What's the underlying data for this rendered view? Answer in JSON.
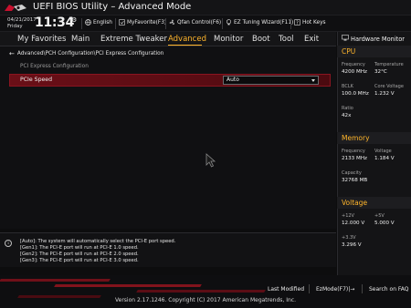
{
  "header": {
    "title": "UEFI BIOS Utility – Advanced Mode",
    "date": "04/21/2017",
    "day": "Friday",
    "time": "11:34",
    "tools": [
      {
        "label": "English",
        "icon": "globe-icon"
      },
      {
        "label": "MyFavorite(F3)",
        "icon": "favorite-icon"
      },
      {
        "label": "Qfan Control(F6)",
        "icon": "fan-icon"
      },
      {
        "label": "EZ Tuning Wizard(F11)",
        "icon": "bulb-icon"
      },
      {
        "label": "Hot Keys",
        "icon": "question-icon"
      }
    ]
  },
  "tabs": [
    "My Favorites",
    "Main",
    "Extreme Tweaker",
    "Advanced",
    "Monitor",
    "Boot",
    "Tool",
    "Exit"
  ],
  "active_tab": "Advanced",
  "main": {
    "breadcrumb": "Advanced\\PCH Configuration\\PCI Express Configuration",
    "section_title": "PCI Express Configuration",
    "setting": {
      "label": "PCIe Speed",
      "value": "Auto"
    }
  },
  "help": {
    "lines": [
      "[Auto]: The system will automatically select the PCI-E port speed.",
      "[Gen1]: The PCI-E port will run at PCI-E 1.0 speed.",
      "[Gen2]: The PCI-E port will run at PCI-E 2.0 speed.",
      "[Gen3]: The PCI-E port will run at PCI-E 3.0 speed."
    ]
  },
  "hardware_monitor": {
    "title": "Hardware Monitor",
    "cpu": {
      "label": "CPU",
      "frequency_label": "Frequency",
      "frequency": "4200 MHz",
      "temperature_label": "Temperature",
      "temperature": "32°C",
      "bclk_label": "BCLK",
      "bclk": "100.0 MHz",
      "core_voltage_label": "Core Voltage",
      "core_voltage": "1.232 V",
      "ratio_label": "Ratio",
      "ratio": "42x"
    },
    "memory": {
      "label": "Memory",
      "frequency_label": "Frequency",
      "frequency": "2133 MHz",
      "voltage_label": "Voltage",
      "voltage": "1.184 V",
      "capacity_label": "Capacity",
      "capacity": "32768 MB"
    },
    "voltage": {
      "label": "Voltage",
      "v12_label": "+12V",
      "v12": "12.000 V",
      "v5_label": "+5V",
      "v5": "5.000 V",
      "v33_label": "+3.3V",
      "v33": "3.296 V"
    }
  },
  "footer": {
    "last_modified": "Last Modified",
    "ezmode": "EzMode(F7)|→",
    "search": "Search on FAQ",
    "version": "Version 2.17.1246. Copyright (C) 2017 American Megatrends, Inc."
  },
  "colors": {
    "accent": "#ffb52b",
    "highlight": "#6a0f17",
    "background": "#0d0d0e"
  }
}
